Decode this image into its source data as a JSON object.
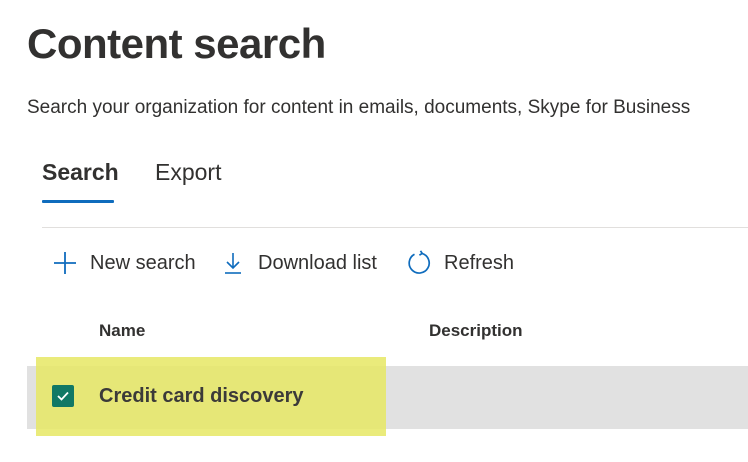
{
  "header": {
    "title": "Content search",
    "subtitle": "Search your organization for content in emails, documents, Skype for Business"
  },
  "tabs": [
    {
      "label": "Search",
      "selected": true
    },
    {
      "label": "Export",
      "selected": false
    }
  ],
  "command_bar": {
    "new_search": {
      "label": "New search",
      "icon": "plus-icon"
    },
    "download_list": {
      "label": "Download list",
      "icon": "download-icon"
    },
    "refresh": {
      "label": "Refresh",
      "icon": "refresh-icon"
    }
  },
  "table": {
    "columns": [
      "Name",
      "Description"
    ],
    "rows": [
      {
        "name": "Credit card discovery",
        "description": "",
        "selected": true
      }
    ]
  },
  "colors": {
    "accent": "#0f6cbd",
    "checkbox": "#117865",
    "row_selected": "#e1e1e1",
    "highlight": "#e6e864"
  }
}
